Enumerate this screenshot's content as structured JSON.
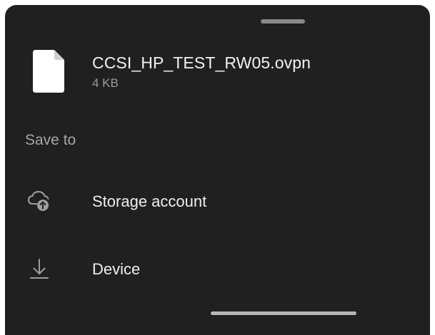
{
  "file": {
    "name": "CCSI_HP_TEST_RW05.ovpn",
    "size": "4 KB",
    "icon": "file-icon"
  },
  "save_to": {
    "label": "Save to",
    "options": [
      {
        "label": "Storage account",
        "icon": "cloud-upload-icon"
      },
      {
        "label": "Device",
        "icon": "download-icon"
      }
    ]
  },
  "colors": {
    "sheet_background": "#202020",
    "primary_text": "#f2f2f2",
    "secondary_text": "#9a9a9a"
  }
}
